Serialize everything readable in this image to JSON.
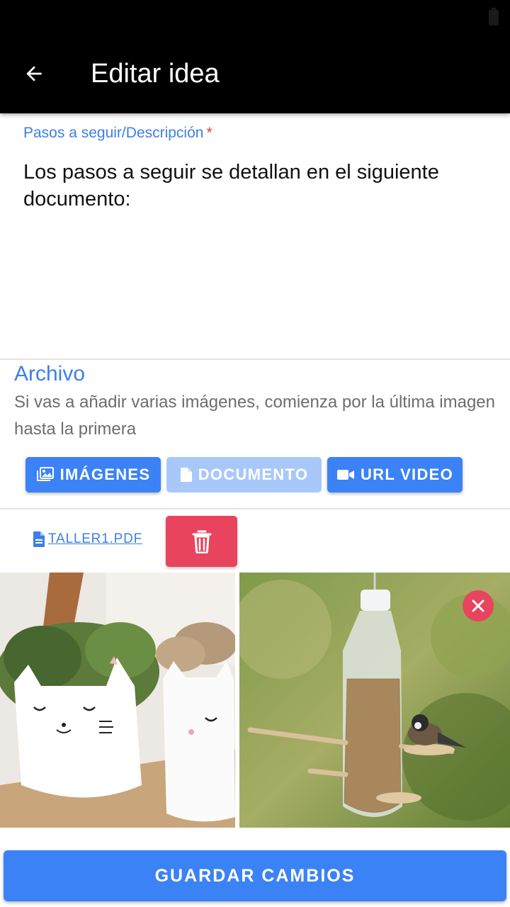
{
  "app_bar": {
    "title": "Editar idea",
    "back_icon": "arrow-left-icon"
  },
  "description": {
    "label": "Pasos a seguir/Descripción",
    "required_mark": "*",
    "value": "Los pasos a seguir se detallan en el siguiente documento:"
  },
  "archivo": {
    "title": "Archivo",
    "help": "Si vas a añadir varias imágenes, comienza por la última imagen hasta la primera",
    "buttons": [
      {
        "label": "IMÁGENES",
        "icon": "images-icon",
        "state": "enabled"
      },
      {
        "label": "DOCUMENTO",
        "icon": "document-icon",
        "state": "disabled"
      },
      {
        "label": "URL VIDEO",
        "icon": "video-camera-icon",
        "state": "enabled"
      }
    ]
  },
  "attached_file": {
    "name": "TALLER1.PDF",
    "icon": "file-icon",
    "delete_icon": "trash-icon"
  },
  "photos": [
    {
      "subject": "cat-bottle-planters"
    },
    {
      "subject": "bottle-bird-feeder",
      "remove_icon": "close-icon"
    }
  ],
  "save_button": {
    "label": "GUARDAR CAMBIOS"
  },
  "colors": {
    "primary": "#3b82f6",
    "primary_disabled": "#a9c8fa",
    "accent_text": "#3d7fe6",
    "danger": "#e8445e",
    "app_bar": "#000000"
  }
}
